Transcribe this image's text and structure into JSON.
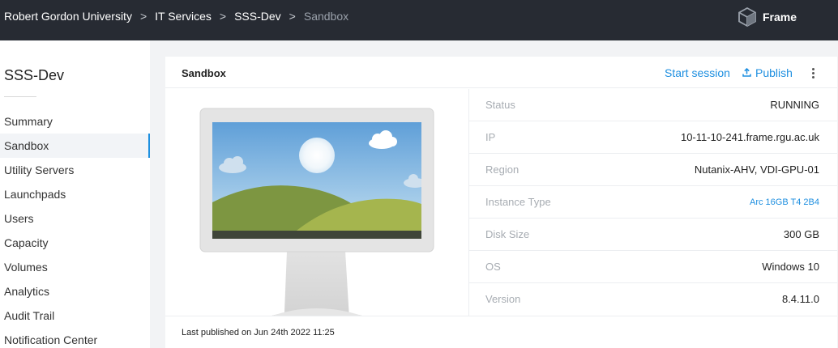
{
  "breadcrumb": [
    {
      "label": "Robert Gordon University"
    },
    {
      "label": "IT Services"
    },
    {
      "label": "SSS-Dev"
    },
    {
      "label": "Sandbox"
    }
  ],
  "brand": {
    "name": "Frame",
    "icon": "cube-icon"
  },
  "sidebar": {
    "title": "SSS-Dev",
    "items": [
      {
        "label": "Summary"
      },
      {
        "label": "Sandbox",
        "active": true
      },
      {
        "label": "Utility Servers"
      },
      {
        "label": "Launchpads"
      },
      {
        "label": "Users"
      },
      {
        "label": "Capacity"
      },
      {
        "label": "Volumes"
      },
      {
        "label": "Analytics"
      },
      {
        "label": "Audit Trail"
      },
      {
        "label": "Notification Center"
      }
    ]
  },
  "card": {
    "title": "Sandbox",
    "actions": {
      "start": "Start session",
      "publish": "Publish",
      "publish_icon": "upload-icon",
      "more_icon": "kebab-menu-icon"
    },
    "info": [
      {
        "label": "Status",
        "value": "RUNNING"
      },
      {
        "label": "IP",
        "value": "10-11-10-241.frame.rgu.ac.uk"
      },
      {
        "label": "Region",
        "value": "Nutanix-AHV, VDI-GPU-01"
      },
      {
        "label": "Instance Type",
        "value": "Arc 16GB T4 2B4",
        "link": true
      },
      {
        "label": "Disk Size",
        "value": "300 GB"
      },
      {
        "label": "OS",
        "value": "Windows 10"
      },
      {
        "label": "Version",
        "value": "8.4.11.0"
      }
    ],
    "footer": "Last published on Jun 24th 2022 11:25"
  },
  "colors": {
    "topbar": "#272b33",
    "accent": "#1e8fe0",
    "label": "#a7acb2"
  }
}
